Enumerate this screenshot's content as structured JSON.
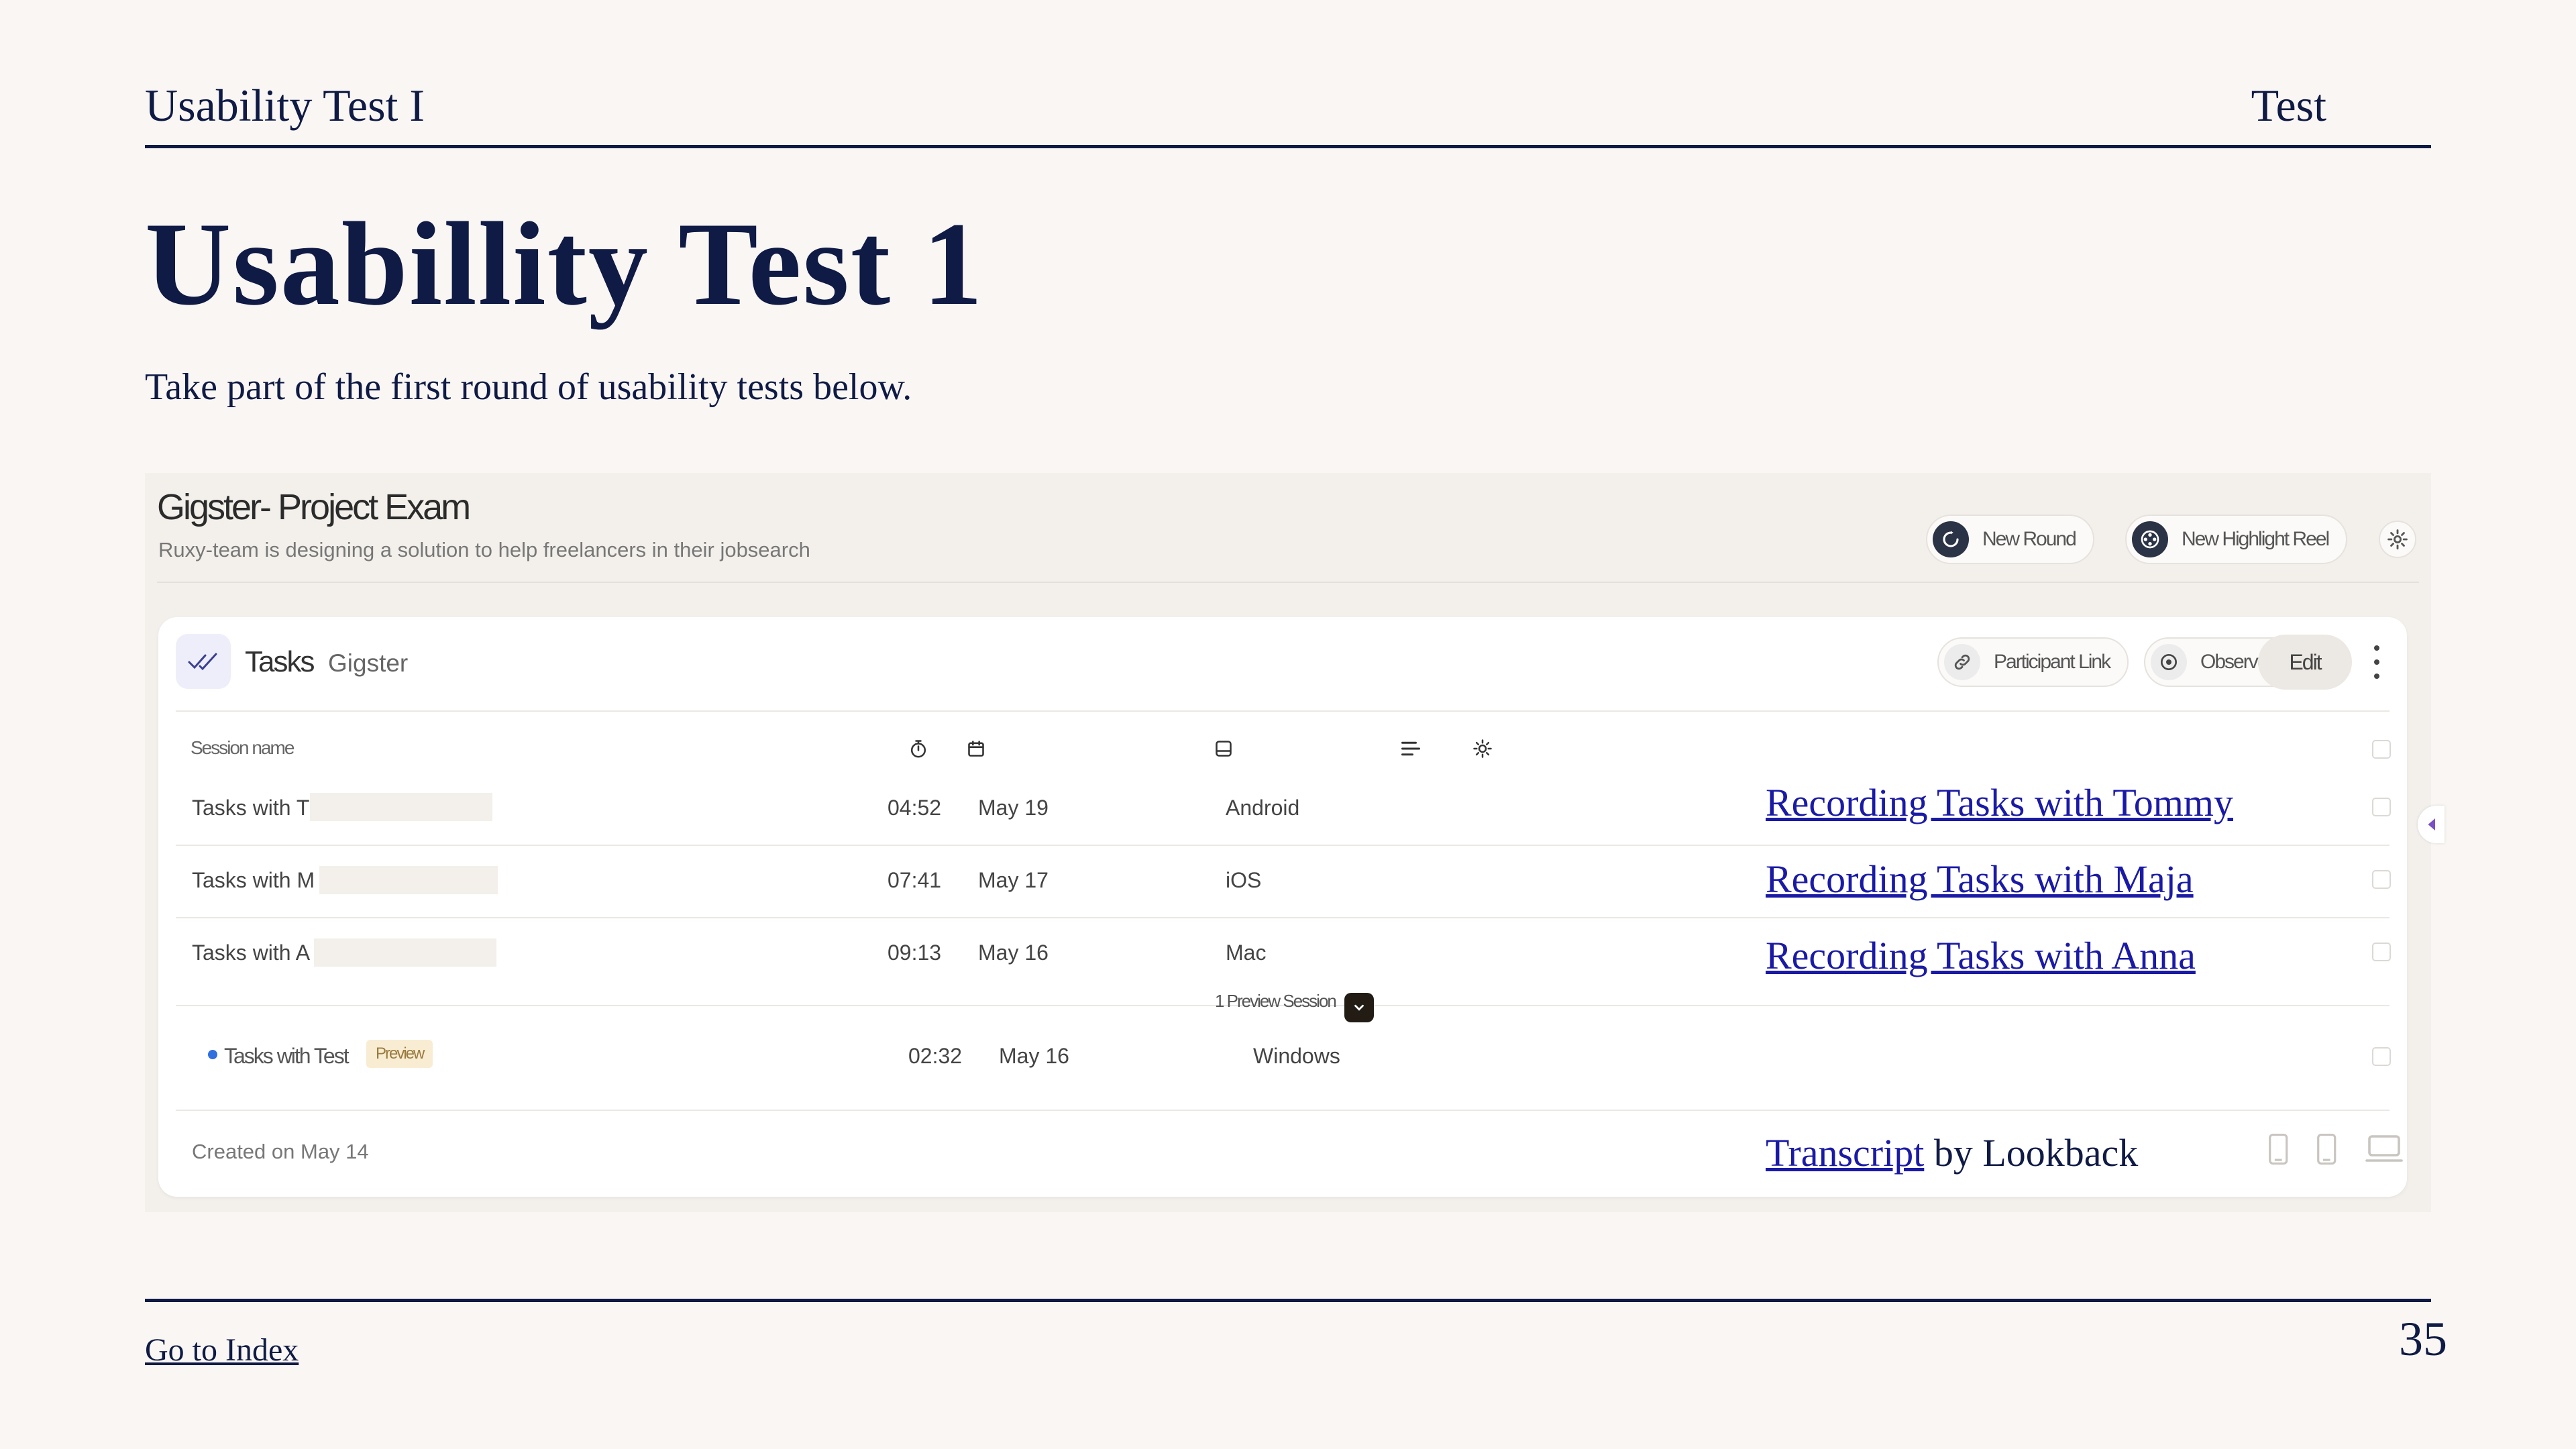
{
  "header": {
    "section_title": "Usability Test I",
    "category": "Test"
  },
  "page_title": "Usabillity Test 1",
  "subtitle": "Take part of the first round of usability tests below.",
  "project": {
    "title": "Gigster- Project Exam",
    "description": "Ruxy-team is designing a solution to help freelancers in their jobsearch",
    "buttons": {
      "new_round": "New Round",
      "new_highlight_reel": "New Highlight Reel"
    }
  },
  "tasks_card": {
    "title": "Tasks",
    "subtitle": "Gigster",
    "buttons": {
      "participant_link": "Participant Link",
      "observer_lobby": "Observer Lobby",
      "edit": "Edit"
    },
    "column_header": "Session name",
    "sessions": [
      {
        "name": "Tasks with T",
        "duration": "04:52",
        "date": "May 19",
        "platform": "Android",
        "recording_link": "Recording Tasks with Tommy"
      },
      {
        "name": "Tasks with M",
        "duration": "07:41",
        "date": "May 17",
        "platform": "iOS",
        "recording_link": "Recording Tasks with Maja"
      },
      {
        "name": "Tasks with A",
        "duration": "09:13",
        "date": "May 16",
        "platform": "Mac",
        "recording_link": "Recording Tasks with Anna"
      }
    ],
    "preview_separator": "1 Preview Session",
    "preview_session": {
      "name": "Tasks with Test",
      "badge": "Preview",
      "duration": "02:32",
      "date": "May 16",
      "platform": "Windows"
    },
    "created_on": "Created on May 14",
    "transcript_link": "Transcript",
    "transcript_by": " by Lookback"
  },
  "footer": {
    "index_link": "Go to Index",
    "page_number": "35"
  },
  "colors": {
    "navy": "#0f1a45",
    "link_blue": "#1a1aa6",
    "background": "#f9f6f3",
    "preview_dot": "#2f6fe0"
  }
}
